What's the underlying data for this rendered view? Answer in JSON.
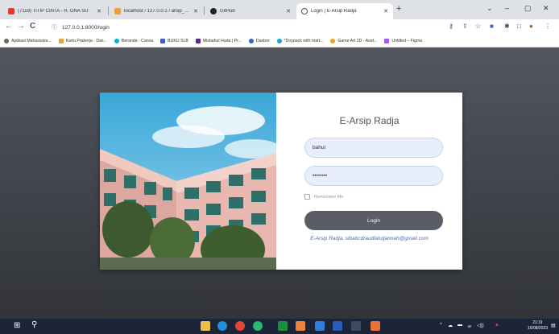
{
  "browser": {
    "tabs": [
      {
        "title": "(7119) TITIP CINTA - H. ONA SU",
        "icon": "youtube-icon",
        "color": "#e53935",
        "active": false
      },
      {
        "title": "localhost / 127.0.0.1 / arsip_app",
        "icon": "phpmyadmin-icon",
        "color": "#f0a030",
        "active": false
      },
      {
        "title": "GitHub",
        "icon": "github-icon",
        "color": "#222222",
        "active": false
      },
      {
        "title": "Login | E-Arsip Radja",
        "icon": "globe-icon",
        "color": "#555555",
        "active": true
      }
    ],
    "new_tab": "+",
    "window_controls": {
      "minimize": "–",
      "maximize": "▢",
      "close": "✕",
      "tab_search": "⌄"
    },
    "nav": {
      "back": "←",
      "forward": "→",
      "reload": "C"
    },
    "url": "127.0.0.1:8000/login",
    "bookmarks": [
      {
        "label": "Aplikasi Mahasiswa...",
        "color": "#666666"
      },
      {
        "label": "Kartu Prakerja - Das...",
        "color": "#e8a33a"
      },
      {
        "label": "Beranda - Canva",
        "color": "#00b4d8"
      },
      {
        "label": "BUKU SLB",
        "color": "#3b5bdb"
      },
      {
        "label": "Misbahul Huda | Pr...",
        "color": "#5b2a86"
      },
      {
        "label": "Dasbor",
        "color": "#2a6ebb"
      },
      {
        "label": "*Doypack with matt...",
        "color": "#1ca0d8"
      },
      {
        "label": "Game Art 2D - Aset...",
        "color": "#f0a020"
      },
      {
        "label": "Untitled – Figma",
        "color": "#a259ff"
      }
    ]
  },
  "login": {
    "title": "E-Arsip Radja",
    "username_value": "bahul",
    "password_value": "••••••••",
    "remember_label": "Remember Me",
    "login_button": "Login",
    "footer": "E-Arsip Radja, slbabcdraudlatuljannah@gmail.com"
  },
  "taskbar": {
    "time": "21:31",
    "date": "16/08/2023"
  }
}
